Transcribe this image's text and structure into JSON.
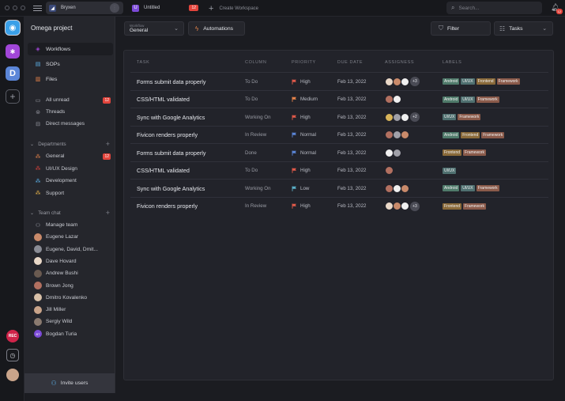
{
  "titlebar": {
    "tabs": [
      {
        "label": "Bryxen",
        "badge": ""
      },
      {
        "label": "Untitled",
        "badge": "12"
      }
    ],
    "create_workspace": "Create Workspace",
    "search_placeholder": "Search...",
    "notifications_badge": "12"
  },
  "rail": {
    "rec_label": "REC",
    "ws2_glyph": "✱",
    "ws3_glyph": "D",
    "add_glyph": "+"
  },
  "sidebar": {
    "project": "Omega project",
    "nav": [
      {
        "label": "Workflows",
        "icon_color": "#a146d8"
      },
      {
        "label": "SOPs",
        "icon_color": "#5bb0e8"
      },
      {
        "label": "Files",
        "icon_color": "#e8844a"
      }
    ],
    "inbox": [
      {
        "label": "All unread",
        "count": "12"
      },
      {
        "label": "Threads",
        "count": ""
      },
      {
        "label": "Direct messages",
        "count": ""
      }
    ],
    "departments_title": "Departments",
    "departments": [
      {
        "label": "General",
        "count": "12",
        "color": "#e8844a"
      },
      {
        "label": "UI/UX Design",
        "count": "",
        "color": "#e2443c"
      },
      {
        "label": "Development",
        "count": "",
        "color": "#5bb0e8"
      },
      {
        "label": "Support",
        "count": "",
        "color": "#e8b44a"
      }
    ],
    "team_title": "Team chat",
    "team": [
      {
        "label": "Manage team",
        "color": "#9a9ca5",
        "initials": ""
      },
      {
        "label": "Eugene Lazar",
        "color": "#c98a6a",
        "initials": ""
      },
      {
        "label": "Eugene, David, Dmit...",
        "color": "#8a8c95",
        "initials": ""
      },
      {
        "label": "Dave Hovard",
        "color": "#e9d8c8",
        "initials": ""
      },
      {
        "label": "Andrew Bushi",
        "color": "#6a5a50",
        "initials": ""
      },
      {
        "label": "Brown Jong",
        "color": "#b27060",
        "initials": ""
      },
      {
        "label": "Dmitro Kovalenko",
        "color": "#d8c0a8",
        "initials": ""
      },
      {
        "label": "Jill Miller",
        "color": "#c9a48a",
        "initials": ""
      },
      {
        "label": "Sergiy Wild",
        "color": "#8a7a70",
        "initials": ""
      },
      {
        "label": "Bogdan Turia",
        "color": "#7c4ad8",
        "initials": "BT"
      }
    ],
    "invite": "Invite users"
  },
  "toolbar": {
    "workflow_caption": "Workflow",
    "workflow_value": "General",
    "automations": "Automations",
    "filter": "Filter",
    "view": "Tasks"
  },
  "table": {
    "headers": [
      "TASK",
      "COLUMN",
      "PRIORITY",
      "DUE DATE",
      "ASSIGNESS",
      "LABELS"
    ],
    "rows": [
      {
        "task": "Forms submit data properly",
        "column": "To Do",
        "priority": "High",
        "flag": "#e25a4a",
        "due": "Feb 13, 2022",
        "avatars": [
          "a1",
          "a2",
          "a3"
        ],
        "more": "+3",
        "labels": [
          "Android",
          "UI/UX",
          "Frontend",
          "Framework"
        ]
      },
      {
        "task": "CSS/HTML validated",
        "column": "To Do",
        "priority": "Medium",
        "flag": "#e8844a",
        "due": "Feb 13, 2022",
        "avatars": [
          "a6",
          "a3"
        ],
        "more": "",
        "labels": [
          "Android",
          "UI/UX",
          "Framework"
        ]
      },
      {
        "task": "Sync with Google Analytics",
        "column": "Working On",
        "priority": "High",
        "flag": "#e25a4a",
        "due": "Feb 13, 2022",
        "avatars": [
          "a4",
          "a5",
          "a3"
        ],
        "more": "+2",
        "labels": [
          "UI/UX",
          "Framework"
        ]
      },
      {
        "task": "Fivicon renders properly",
        "column": "In Review",
        "priority": "Normal",
        "flag": "#5b86d8",
        "due": "Feb 13, 2022",
        "avatars": [
          "a6",
          "a5",
          "a2"
        ],
        "more": "",
        "labels": [
          "Android",
          "Frontend",
          "Framework"
        ]
      },
      {
        "task": "Forms submit data properly",
        "column": "Done",
        "priority": "Normal",
        "flag": "#5b86d8",
        "due": "Feb 13, 2022",
        "avatars": [
          "a3",
          "a5"
        ],
        "more": "",
        "labels": [
          "Frontend",
          "Framework"
        ]
      },
      {
        "task": "CSS/HTML validated",
        "column": "To Do",
        "priority": "High",
        "flag": "#e25a4a",
        "due": "Feb 13, 2022",
        "avatars": [
          "a6"
        ],
        "more": "",
        "labels": [
          "UI/UX"
        ]
      },
      {
        "task": "Sync with Google Analytics",
        "column": "Working On",
        "priority": "Low",
        "flag": "#5bb0c8",
        "due": "Feb 13, 2022",
        "avatars": [
          "a6",
          "a3",
          "a2"
        ],
        "more": "",
        "labels": [
          "Android",
          "UI/UX",
          "Framework"
        ]
      },
      {
        "task": "Fivicon renders properly",
        "column": "In Review",
        "priority": "High",
        "flag": "#e25a4a",
        "due": "Feb 13, 2022",
        "avatars": [
          "a1",
          "a2",
          "a3"
        ],
        "more": "+3",
        "labels": [
          "Frontend",
          "Framework"
        ]
      }
    ],
    "label_colors": {
      "Android": "#4f7a6a",
      "UI/UX": "#4f7070",
      "Frontend": "#8a6a3a",
      "Framework": "#8a5a4a"
    }
  }
}
